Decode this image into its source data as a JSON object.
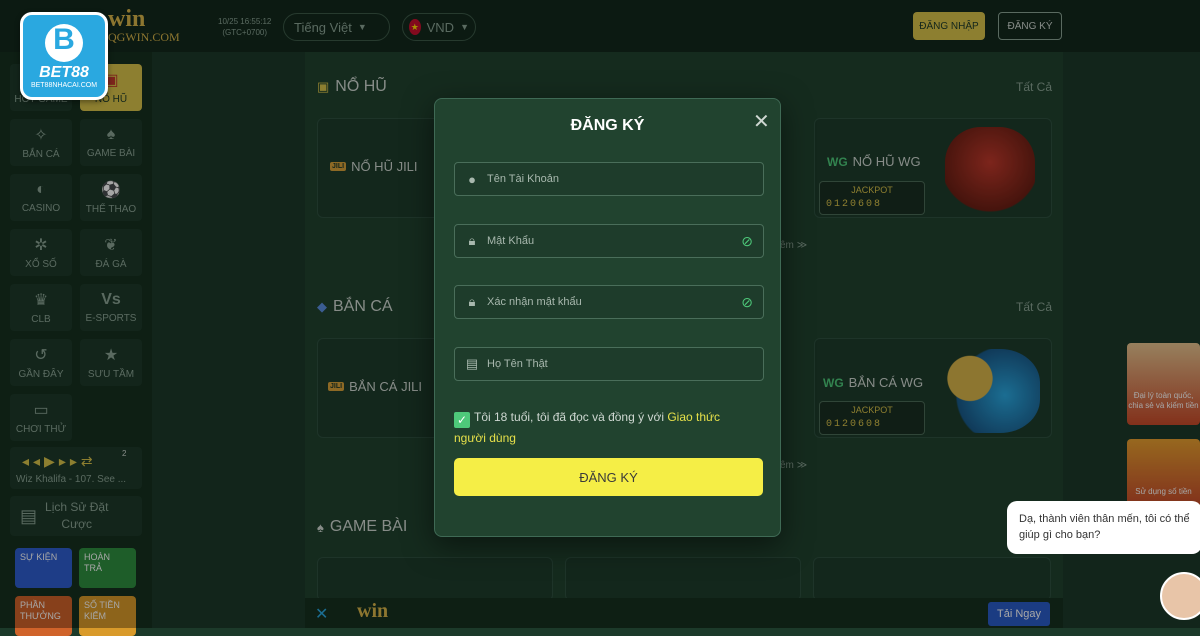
{
  "header": {
    "logo_badge": "B",
    "logo_text": "BET88",
    "logo_sub": "BET88NHACAI.COM",
    "brand_word": "win",
    "brand_domain": "QGWIN.COM",
    "clock_date": "10/25 16:55:12",
    "clock_tz": "(GTC+0700)",
    "language": "Tiếng Việt",
    "currency": "VND",
    "login_label": "ĐĂNG NHẬP",
    "register_label": "ĐĂNG KÝ"
  },
  "sidebar": {
    "items": [
      {
        "label": "HOT GAME"
      },
      {
        "label": "NỔ HŨ"
      },
      {
        "label": "BẮN CÁ"
      },
      {
        "label": "GAME BÀI"
      },
      {
        "label": "CASINO"
      },
      {
        "label": "THỂ THAO"
      },
      {
        "label": "XỔ SỐ"
      },
      {
        "label": "ĐÁ GÀ"
      },
      {
        "label": "CLB"
      },
      {
        "label": "E-SPORTS"
      },
      {
        "label": "GẦN ĐÂY"
      },
      {
        "label": "SƯU TẦM"
      },
      {
        "label": "CHƠI THỬ"
      }
    ],
    "player": {
      "song": "Wiz Khalifa - 107. See ...",
      "badge": "2"
    },
    "history_label_1": "Lịch Sử Đặt",
    "history_label_2": "Cược",
    "promos": [
      {
        "label_1": "SỰ KIỆN",
        "label_2": ""
      },
      {
        "label_1": "HOÀN",
        "label_2": "TRẢ"
      },
      {
        "label_1": "PHẦN",
        "label_2": "THƯỞNG"
      },
      {
        "label_1": "SỐ TIỀN",
        "label_2": "KIẾM"
      }
    ]
  },
  "sections": {
    "slots": {
      "title": "NỔ HŨ",
      "see_all": "Tất Cả",
      "card1": "NỔ HŨ JILI",
      "card2": "NỔ HŨ WG",
      "jackpot_label": "JACKPOT",
      "jackpot_value": "0120608",
      "more": "êm"
    },
    "fishing": {
      "title": "BẮN CÁ",
      "see_all": "Tất Cả",
      "card1": "BẮN CÁ JILI",
      "card2": "BẮN CÁ WG",
      "jackpot_label": "JACKPOT",
      "jackpot_value": "0120608",
      "more": "êm"
    },
    "cards": {
      "title": "GAME BÀI"
    }
  },
  "provider_tags": {
    "jili": "JILI",
    "wg": "WG"
  },
  "right_tiles": [
    {
      "text": "Đại lý toàn quốc, chia sẻ và kiếm tiền"
    },
    {
      "text": "Sử dụng số tiền"
    }
  ],
  "chat": {
    "message": "Dạ, thành viên thân mến, tôi có thể giúp gì cho bạn?"
  },
  "bottom_bar": {
    "brand": "win",
    "download": "Tải Ngay"
  },
  "modal": {
    "title": "ĐĂNG KÝ",
    "username_placeholder": "Tên Tài Khoản",
    "password_placeholder": "Mật Khẩu",
    "confirm_placeholder": "Xác nhận mật khẩu",
    "realname_placeholder": "Họ Tên Thật",
    "agree_text": "Tôi 18 tuổi, tôi đã đọc và đồng ý với ",
    "agree_link": "Giao thức người dùng",
    "submit_label": "ĐĂNG KÝ"
  }
}
